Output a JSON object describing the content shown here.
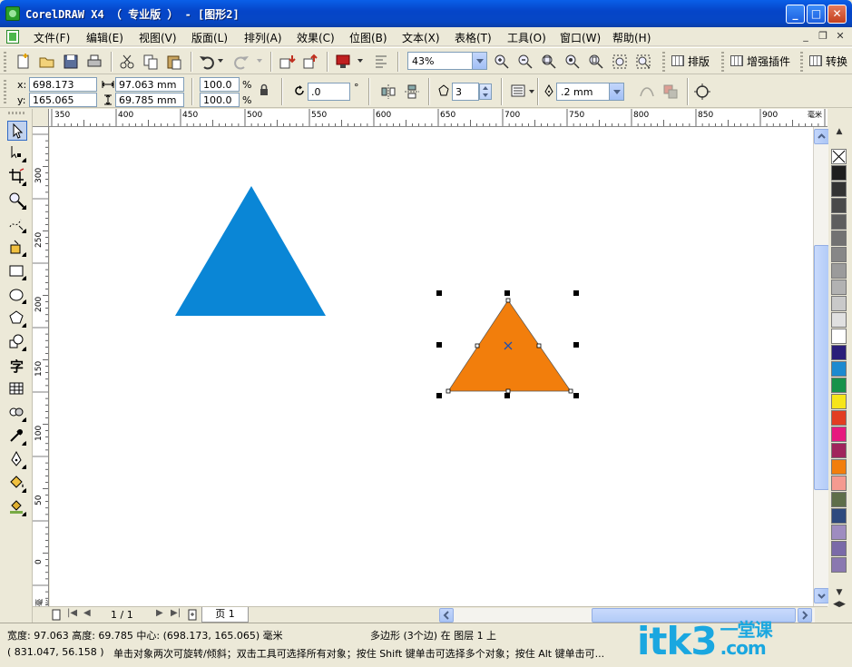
{
  "window": {
    "title": "CorelDRAW X4 （ 专业版 ） - [图形2]"
  },
  "menu": {
    "items": [
      "文件(F)",
      "编辑(E)",
      "视图(V)",
      "版面(L)",
      "排列(A)",
      "效果(C)",
      "位图(B)",
      "文本(X)",
      "表格(T)",
      "工具(O)",
      "窗口(W)",
      "帮助(H)"
    ]
  },
  "toolbar": {
    "zoom_value": "43%",
    "plugin_layout": "排版",
    "plugin_enhance": "增强插件",
    "plugin_convert": "转换"
  },
  "property_bar": {
    "x_label": "x:",
    "x_value": "698.173 mm",
    "y_label": "y:",
    "y_value": "165.065 mm",
    "width_value": "97.063 mm",
    "height_value": "69.785 mm",
    "scale_x": "100.0",
    "scale_y": "100.0",
    "percent_x": "%",
    "percent_y": "%",
    "rotation_value": ".0",
    "degree_symbol": "°",
    "sides_value": "3",
    "outline_width": ".2 mm"
  },
  "rulers": {
    "horizontal_ticks": [
      "350",
      "400",
      "450",
      "500",
      "550",
      "600",
      "650",
      "700",
      "750",
      "800",
      "850",
      "900"
    ],
    "horizontal_unit": "毫米",
    "vertical_ticks": [
      "300",
      "250",
      "200",
      "150",
      "100",
      "50",
      "0"
    ],
    "vertical_unit": "毫米"
  },
  "shapes": {
    "blue_color": "#0a86d6",
    "orange_color": "#f27e0c"
  },
  "page_nav": {
    "page_count": "1 / 1",
    "page_tab": "页 1"
  },
  "palette": {
    "colors": [
      "#ffffff",
      "#1e1e1e",
      "#333333",
      "#4a4a4a",
      "#5e5e5e",
      "#727272",
      "#878787",
      "#9b9b9b",
      "#b2b2b2",
      "#c9c9c9",
      "#e0e0e0",
      "#ffffff",
      "#2a1e7a",
      "#1c8ad0",
      "#17924a",
      "#f6e51a",
      "#e23d21",
      "#e6197e",
      "#a0245c",
      "#f27e0c",
      "#f49a90",
      "#5e6e4a",
      "#2e4a7e",
      "#9e8cc0",
      "#7a6aa8",
      "#8a78b0"
    ]
  },
  "status": {
    "line1_left": "宽度: 97.063 高度: 69.785 中心: (698.173, 165.065) 毫米",
    "line1_center": "多边形 (3个边) 在 图层 1 上",
    "coords": "( 831.047, 56.158 )",
    "hint": "单击对象两次可旋转/倾斜；双击工具可选择所有对象；按住 Shift 键单击可选择多个对象；按住 Alt 键单击可..."
  },
  "watermark": {
    "text": "itk3",
    "suffix_top": "一堂课",
    "suffix_bottom": ".com"
  }
}
